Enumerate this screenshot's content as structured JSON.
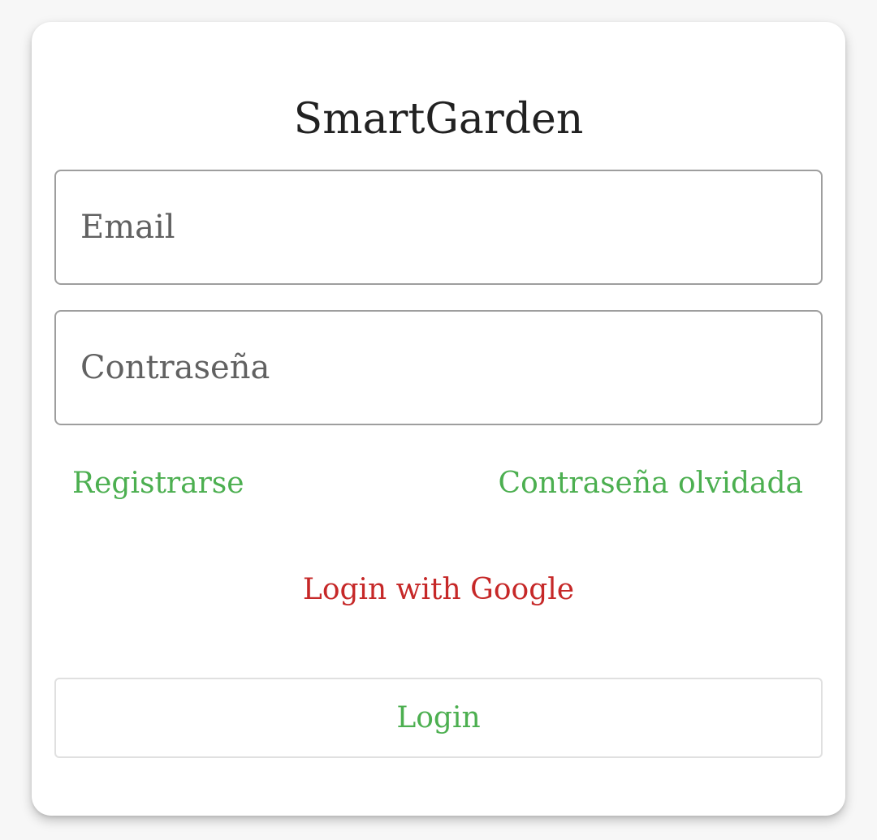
{
  "app": {
    "title": "SmartGarden"
  },
  "form": {
    "email": {
      "placeholder": "Email",
      "value": ""
    },
    "password": {
      "placeholder": "Contraseña",
      "value": ""
    }
  },
  "links": {
    "register": "Registrarse",
    "forgot_password": "Contraseña olvidada",
    "google_login": "Login with Google"
  },
  "actions": {
    "login_label": "Login"
  },
  "colors": {
    "primary_green": "#4caf50",
    "google_red": "#c62828",
    "title_text": "#212121",
    "field_border": "#9e9e9e"
  }
}
